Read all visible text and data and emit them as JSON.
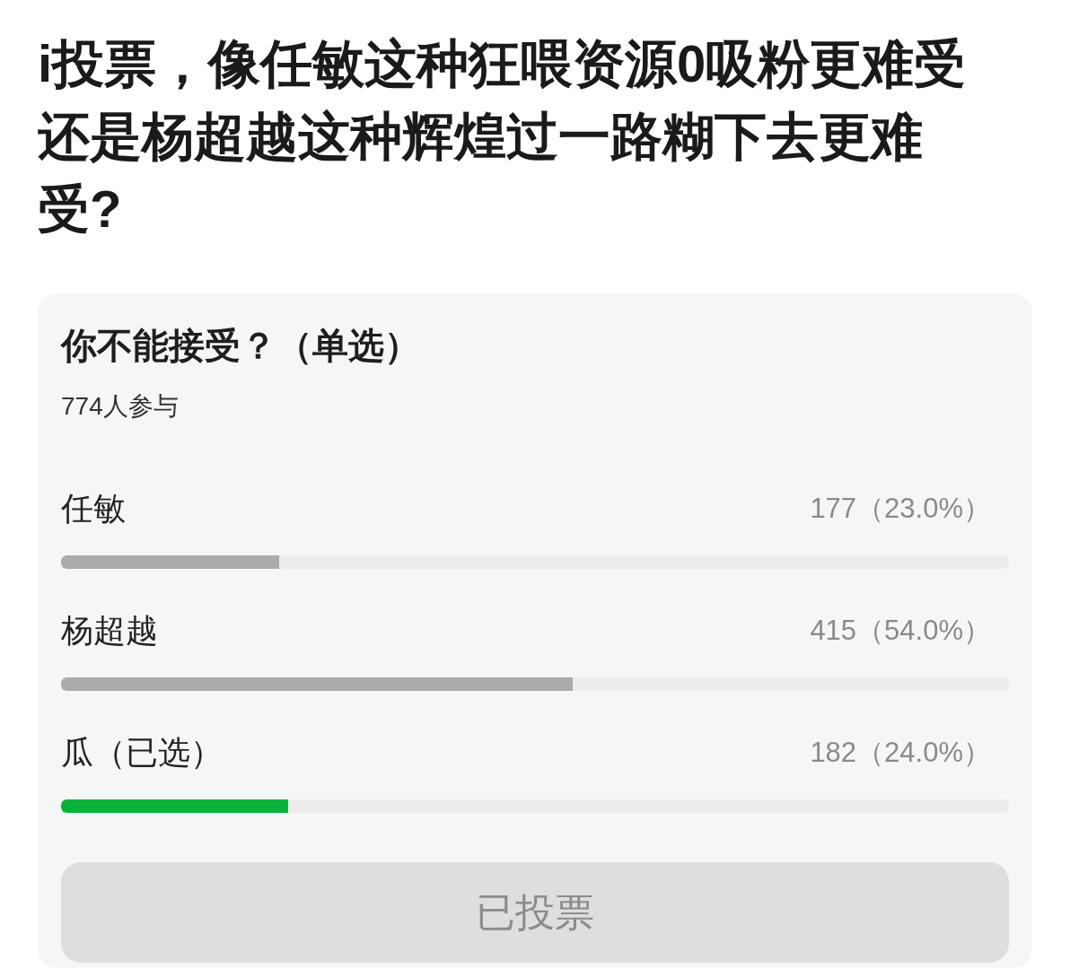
{
  "post": {
    "title": "i投票，像任敏这种狂喂资源0吸粉更难受还是杨超越这种辉煌过一路糊下去更难受?"
  },
  "poll": {
    "question": "你不能接受？（单选）",
    "participants": "774人参与",
    "options": [
      {
        "label": "任敏",
        "count": "177（23.0%）",
        "level": 0.23,
        "selected": false
      },
      {
        "label": "杨超越",
        "count": "415（54.0%）",
        "level": 0.54,
        "selected": false
      },
      {
        "label": "瓜（已选）",
        "count": "182（24.0%）",
        "level": 0.24,
        "selected": true
      }
    ],
    "button": {
      "label": "已投票",
      "disabled": true
    }
  }
}
